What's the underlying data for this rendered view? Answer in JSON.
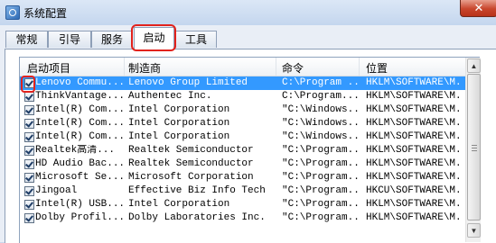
{
  "window": {
    "title": "系统配置",
    "close_label": "✕"
  },
  "tabs": [
    {
      "label": "常规"
    },
    {
      "label": "引导"
    },
    {
      "label": "服务"
    },
    {
      "label": "启动",
      "active": true
    },
    {
      "label": "工具"
    }
  ],
  "table": {
    "columns": [
      "启动项目",
      "制造商",
      "命令",
      "位置"
    ],
    "rows": [
      {
        "item": "Lenovo Commu...",
        "maker": "Lenovo Group Limited",
        "command": "C:\\Program ...",
        "location": "HKLM\\SOFTWARE\\M...",
        "checked": true,
        "selected": true
      },
      {
        "item": "ThinkVantage...",
        "maker": "Authentec Inc.",
        "command": "C:\\Program...",
        "location": "HKLM\\SOFTWARE\\M...",
        "checked": true
      },
      {
        "item": "Intel(R) Com...",
        "maker": "Intel Corporation",
        "command": "\"C:\\Windows...",
        "location": "HKLM\\SOFTWARE\\M...",
        "checked": true
      },
      {
        "item": "Intel(R) Com...",
        "maker": "Intel Corporation",
        "command": "\"C:\\Windows...",
        "location": "HKLM\\SOFTWARE\\M...",
        "checked": true
      },
      {
        "item": "Intel(R) Com...",
        "maker": "Intel Corporation",
        "command": "\"C:\\Windows...",
        "location": "HKLM\\SOFTWARE\\M...",
        "checked": true
      },
      {
        "item": "Realtek高清...",
        "maker": "Realtek Semiconductor",
        "command": "\"C:\\Program...",
        "location": "HKLM\\SOFTWARE\\M...",
        "checked": true
      },
      {
        "item": "HD Audio Bac...",
        "maker": "Realtek Semiconductor",
        "command": "\"C:\\Program...",
        "location": "HKLM\\SOFTWARE\\M...",
        "checked": true
      },
      {
        "item": "Microsoft Se...",
        "maker": "Microsoft Corporation",
        "command": "\"C:\\Program...",
        "location": "HKLM\\SOFTWARE\\M...",
        "checked": true
      },
      {
        "item": "Jingoal",
        "maker": "Effective Biz Info Tech ...",
        "command": "\"C:\\Program...",
        "location": "HKCU\\SOFTWARE\\M...",
        "checked": true
      },
      {
        "item": "Intel(R) USB...",
        "maker": "Intel Corporation",
        "command": "\"C:\\Program...",
        "location": "HKLM\\SOFTWARE\\M...",
        "checked": true
      },
      {
        "item": "Dolby Profil...",
        "maker": "Dolby Laboratories Inc.",
        "command": "\"C:\\Program...",
        "location": "HKLM\\SOFTWARE\\M...",
        "checked": true
      }
    ]
  },
  "scrollbar": {
    "up_arrow": "▲",
    "down_arrow": "▼"
  },
  "colors": {
    "selection": "#3399ff",
    "highlight": "#e2221c"
  }
}
